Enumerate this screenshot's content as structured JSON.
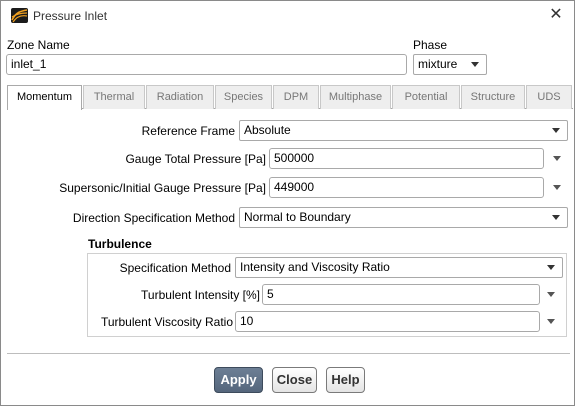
{
  "window": {
    "title": "Pressure Inlet",
    "close_glyph": "✕"
  },
  "zone": {
    "label": "Zone Name",
    "value": "inlet_1"
  },
  "phase": {
    "label": "Phase",
    "value": "mixture"
  },
  "tabs": [
    {
      "label": "Momentum",
      "active": true
    },
    {
      "label": "Thermal",
      "active": false
    },
    {
      "label": "Radiation",
      "active": false
    },
    {
      "label": "Species",
      "active": false
    },
    {
      "label": "DPM",
      "active": false
    },
    {
      "label": "Multiphase",
      "active": false
    },
    {
      "label": "Potential",
      "active": false
    },
    {
      "label": "Structure",
      "active": false
    },
    {
      "label": "UDS",
      "active": false
    }
  ],
  "momentum": {
    "reference_frame": {
      "label": "Reference Frame",
      "value": "Absolute"
    },
    "gauge_total_pressure": {
      "label": "Gauge Total Pressure [Pa]",
      "value": "500000"
    },
    "supersonic_pressure": {
      "label": "Supersonic/Initial Gauge Pressure [Pa]",
      "value": "449000"
    },
    "direction_method": {
      "label": "Direction Specification Method",
      "value": "Normal to Boundary"
    }
  },
  "turbulence": {
    "heading": "Turbulence",
    "spec_method": {
      "label": "Specification Method",
      "value": "Intensity and Viscosity Ratio"
    },
    "intensity": {
      "label": "Turbulent Intensity [%]",
      "value": "5"
    },
    "viscosity_ratio": {
      "label": "Turbulent Viscosity Ratio",
      "value": "10"
    }
  },
  "buttons": {
    "apply": "Apply",
    "close": "Close",
    "help": "Help"
  },
  "colors": {
    "apply_button": "#5f7086",
    "tab_inactive": "#eeeeee",
    "border": "#a9a9a9"
  },
  "icons": {
    "app": "fluent-app-icon",
    "close": "close-icon"
  }
}
